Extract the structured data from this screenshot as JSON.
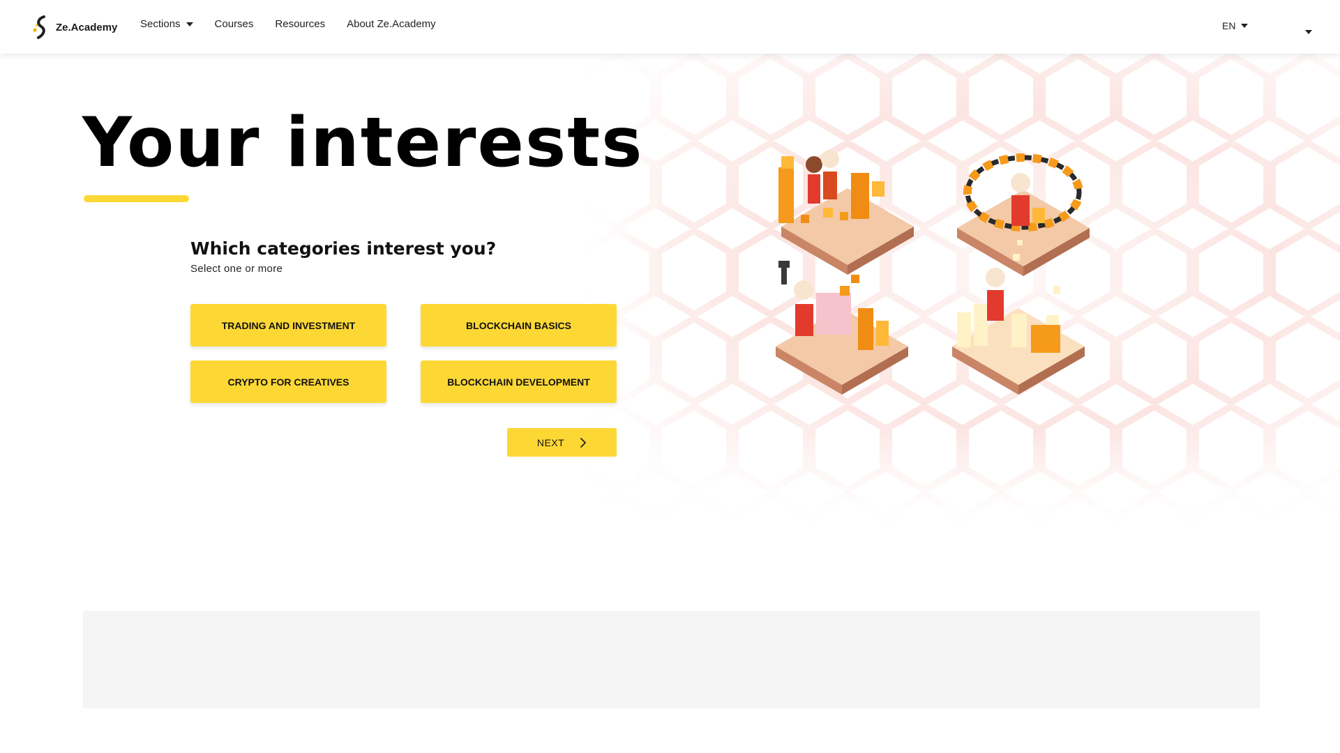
{
  "header": {
    "logo_text": "Ze.Academy",
    "nav": {
      "sections": "Sections",
      "courses": "Courses",
      "resources": "Resources",
      "about": "About Ze.Academy"
    },
    "language": "EN"
  },
  "hero": {
    "title": "Your interests",
    "question": "Which categories interest you?",
    "hint": "Select one or more",
    "categories": [
      "TRADING AND INVESTMENT",
      "BLOCKCHAIN BASICS",
      "CRYPTO FOR CREATIVES",
      "BLOCKCHAIN DEVELOPMENT"
    ],
    "next_label": "NEXT"
  },
  "colors": {
    "accent": "#fdd835",
    "text": "#111111",
    "pattern": "#f7c9c4",
    "panel": "#f5f5f5"
  },
  "icons": [
    "logo-icon",
    "caret-down-icon",
    "chevron-right-icon",
    "isometric-crypto-illustration"
  ]
}
